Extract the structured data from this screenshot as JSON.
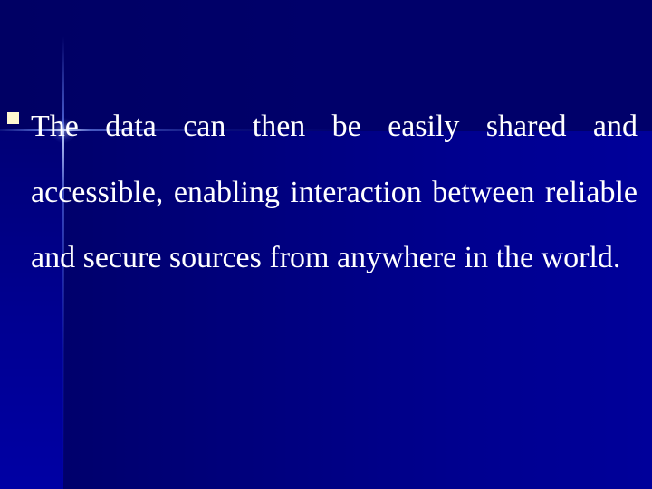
{
  "slide": {
    "bullet_icon": "square-bullet-icon",
    "paragraph": "The data can then be easily shared and accessible, enabling interaction between reliable and secure sources from anywhere in the world.",
    "colors": {
      "background_top": "#000066",
      "background_lower": "#00009a",
      "text": "#ffffff",
      "bullet": "#fff8d0"
    }
  }
}
